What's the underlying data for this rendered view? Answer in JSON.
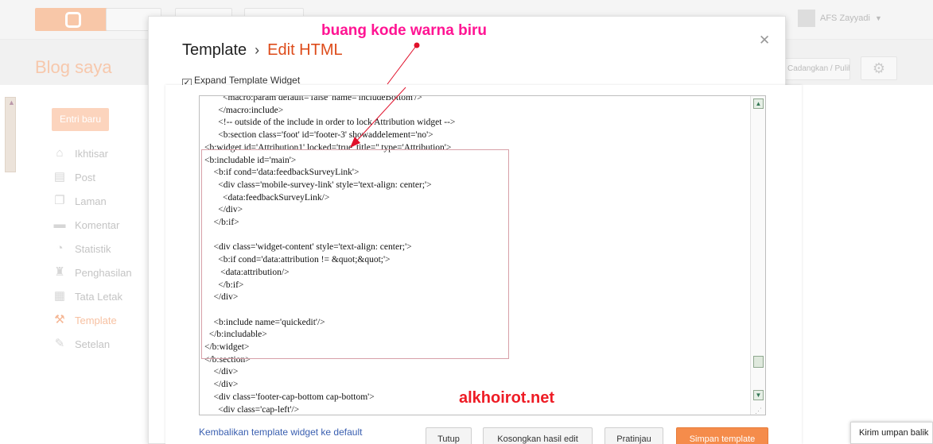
{
  "topbar": {
    "user_name": "AFS Zayyadi"
  },
  "background": {
    "blog_title": "Blog saya",
    "restore_label": "Cadangkan / Pulihkan",
    "new_post_label": "Entri baru",
    "nav_items": [
      {
        "label": "Ikhtisar",
        "icon": "home-icon"
      },
      {
        "label": "Post",
        "icon": "posts-icon"
      },
      {
        "label": "Laman",
        "icon": "pages-icon"
      },
      {
        "label": "Komentar",
        "icon": "comments-icon"
      },
      {
        "label": "Statistik",
        "icon": "stats-icon"
      },
      {
        "label": "Penghasilan",
        "icon": "trophy-icon"
      },
      {
        "label": "Tata Letak",
        "icon": "layout-icon"
      },
      {
        "label": "Template",
        "icon": "template-icon"
      },
      {
        "label": "Setelan",
        "icon": "wrench-icon"
      }
    ]
  },
  "modal": {
    "breadcrumb_root": "Template",
    "breadcrumb_sep": "›",
    "breadcrumb_current": "Edit HTML",
    "expand_label": "Expand Template Widget",
    "code_lines": [
      "        <macro:param default='false' name='includeBottom'/>",
      "      </macro:include>",
      "      <!-- outside of the include in order to lock Attribution widget -->",
      "      <b:section class='foot' id='footer-3' showaddelement='no'>",
      "<b:widget id='Attribution1' locked='true' title='' type='Attribution'>",
      "<b:includable id='main'>",
      "    <b:if cond='data:feedbackSurveyLink'>",
      "      <div class='mobile-survey-link' style='text-align: center;'>",
      "        <data:feedbackSurveyLink/>",
      "      </div>",
      "    </b:if>",
      "",
      "    <div class='widget-content' style='text-align: center;'>",
      "      <b:if cond='data:attribution != &quot;&quot;'>",
      "       <data:attribution/>",
      "      </b:if>",
      "    </div>",
      "",
      "    <b:include name='quickedit'/>",
      "  </b:includable>",
      "</b:widget>",
      "</b:section>",
      "    </div>",
      "    </div>",
      "    <div class='footer-cap-bottom cap-bottom'>",
      "      <div class='cap-left'/>"
    ],
    "revert_link": "Kembalikan template widget ke default",
    "buttons": {
      "close": "Tutup",
      "clear_edits": "Kosongkan hasil edit",
      "preview": "Pratinjau",
      "save": "Simpan template"
    }
  },
  "feedback": {
    "label": "Kirim umpan balik"
  },
  "annotations": {
    "top_note": "buang kode warna biru",
    "watermark": "alkhoirot.net"
  }
}
